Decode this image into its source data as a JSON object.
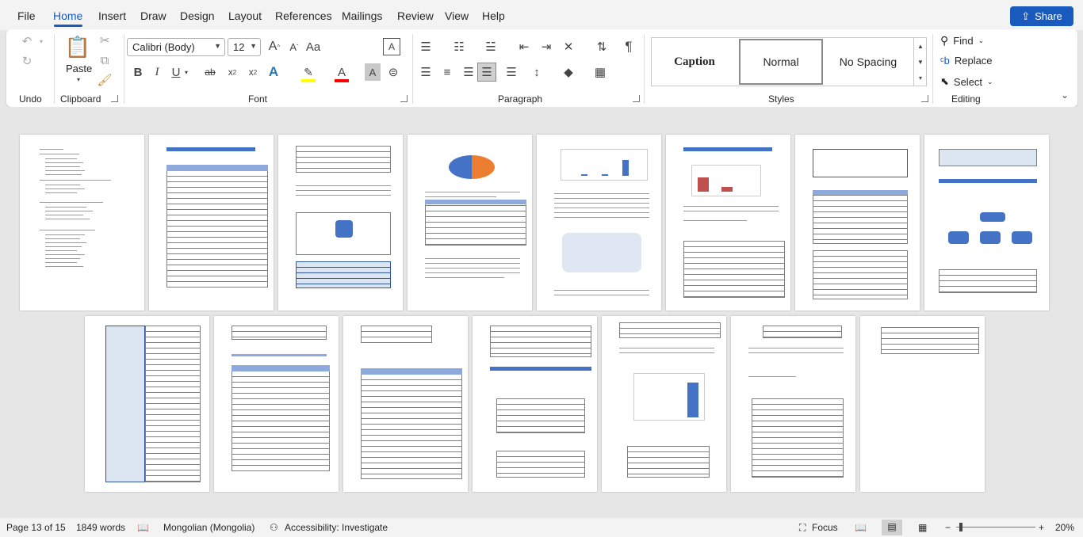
{
  "menu": {
    "tabs": [
      "File",
      "Home",
      "Insert",
      "Draw",
      "Design",
      "Layout",
      "References",
      "Mailings",
      "Review",
      "View",
      "Help"
    ],
    "active": "Home",
    "share": "Share"
  },
  "ribbon": {
    "groups": {
      "undo": "Undo",
      "clipboard": "Clipboard",
      "font": "Font",
      "paragraph": "Paragraph",
      "styles": "Styles",
      "editing": "Editing"
    },
    "paste": "Paste",
    "font_name": "Calibri (Body)",
    "font_size": "12",
    "styles": {
      "caption": "Caption",
      "normal": "Normal",
      "no_spacing": "No Spacing"
    },
    "editing": {
      "find": "Find",
      "replace": "Replace",
      "select": "Select"
    }
  },
  "status": {
    "page": "Page 13 of 15",
    "words": "1849 words",
    "language": "Mongolian (Mongolia)",
    "accessibility": "Accessibility: Investigate",
    "focus": "Focus",
    "zoom": "20%"
  },
  "colors": {
    "accent": "#185abd",
    "highlight": "#ffff00",
    "font_color": "#ff0000"
  }
}
